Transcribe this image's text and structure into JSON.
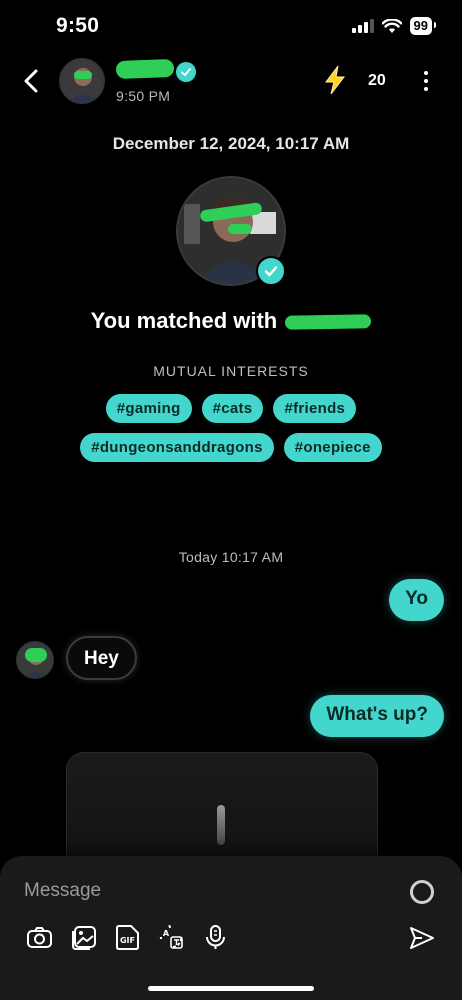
{
  "status_bar": {
    "time": "9:50",
    "battery": "99"
  },
  "header": {
    "last_seen": "9:50 PM",
    "boost_count": "20"
  },
  "match": {
    "date": "December 12, 2024, 10:17 AM",
    "matched_prefix": "You matched with ",
    "mutual_interests_label": "MUTUAL INTERESTS",
    "interests_row1": [
      "#gaming",
      "#cats",
      "#friends"
    ],
    "interests_row2": [
      "#dungeonsanddragons",
      "#onepiece"
    ]
  },
  "chat": {
    "today_label": "Today 10:17 AM",
    "messages": [
      {
        "from": "me",
        "text": "Yo"
      },
      {
        "from": "them",
        "text": "Hey"
      },
      {
        "from": "me",
        "text": "What's up?"
      }
    ]
  },
  "composer": {
    "placeholder": "Message",
    "gif_label": "GIF"
  },
  "colors": {
    "accent": "#43d6cc",
    "background": "#000000",
    "composer_bg": "#1a1a1a",
    "redaction": "#2fcf57"
  },
  "icons": [
    "back-chevron-icon",
    "verified-check-icon",
    "lightning-bolt-icon",
    "more-vertical-icon",
    "camera-icon",
    "gallery-icon",
    "gif-icon",
    "translate-icon",
    "microphone-icon",
    "send-icon"
  ]
}
